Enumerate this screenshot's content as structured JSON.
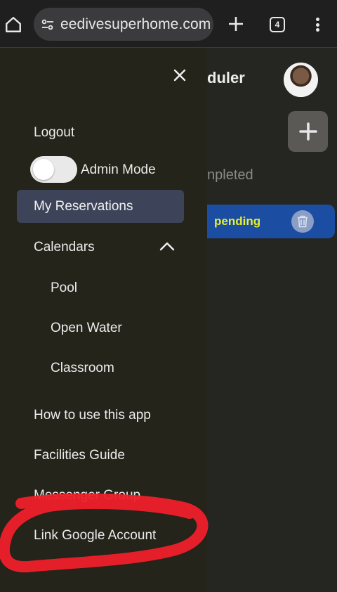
{
  "browser": {
    "url": "eedivesuperhome.com",
    "tab_count": "4"
  },
  "app": {
    "title_fragment": "duler",
    "filter_fragment": "npleted",
    "reservation": {
      "status": "pending"
    }
  },
  "drawer": {
    "logout": "Logout",
    "admin_mode_label": "Admin Mode",
    "my_reservations": "My Reservations",
    "calendars": "Calendars",
    "calendar_items": [
      "Pool",
      "Open Water",
      "Classroom"
    ],
    "how_to_use": "How to use this app",
    "facilities_guide": "Facilities Guide",
    "messenger_group": "Messenger Group",
    "link_google": "Link Google Account"
  },
  "colors": {
    "drawer_bg": "#24241a",
    "active_item_bg": "#3d4459",
    "card_blue": "#1b4ea3",
    "status_yellow": "#e6ee35",
    "annotation_red": "#f0202a"
  }
}
